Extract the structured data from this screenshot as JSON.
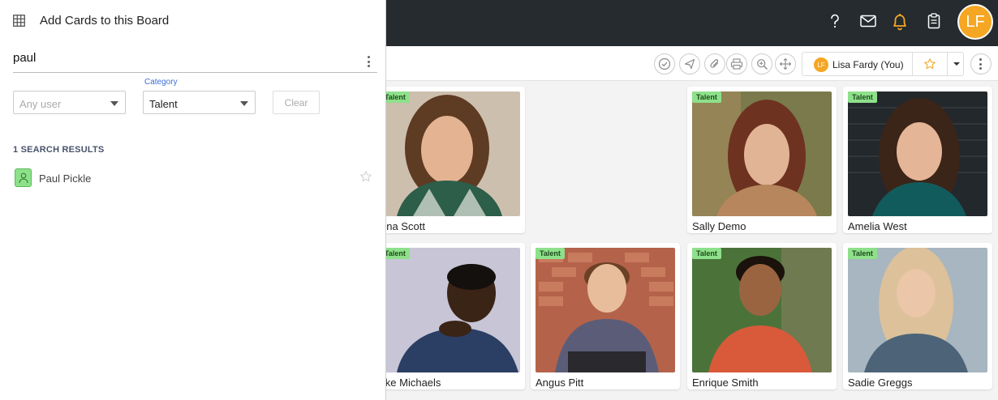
{
  "colors": {
    "topbar": "#252b2f",
    "accent": "#f5a623",
    "tag": "#8ee08a",
    "link": "#3b6fd6"
  },
  "topbar": {
    "icons": [
      "help-icon",
      "mail-icon",
      "bell-icon",
      "clipboard-icon"
    ],
    "avatar_initials": "LF"
  },
  "toolbar": {
    "buttons": [
      "check-icon",
      "send-icon",
      "attach-icon",
      "print-icon",
      "zoom-icon",
      "move-icon"
    ],
    "user": {
      "initials": "LF",
      "name": "Lisa Fardy (You)"
    }
  },
  "panel": {
    "title": "Add Cards to this Board",
    "search_value": "paul",
    "user_filter": {
      "placeholder": "Any user"
    },
    "category_filter": {
      "label": "Category",
      "value": "Talent"
    },
    "clear_label": "Clear",
    "results_heading": "1 SEARCH RESULTS",
    "results": [
      {
        "name": "Paul Pickle"
      }
    ]
  },
  "cards": [
    {
      "name": "nna Scott",
      "tag": "Talent"
    },
    {
      "name": "Sally Demo",
      "tag": "Talent"
    },
    {
      "name": "Amelia West",
      "tag": "Talent"
    },
    {
      "name": "like Michaels",
      "tag": "Talent"
    },
    {
      "name": "Angus Pitt",
      "tag": "Talent"
    },
    {
      "name": "Enrique Smith",
      "tag": "Talent"
    },
    {
      "name": "Sadie Greggs",
      "tag": "Talent"
    }
  ]
}
